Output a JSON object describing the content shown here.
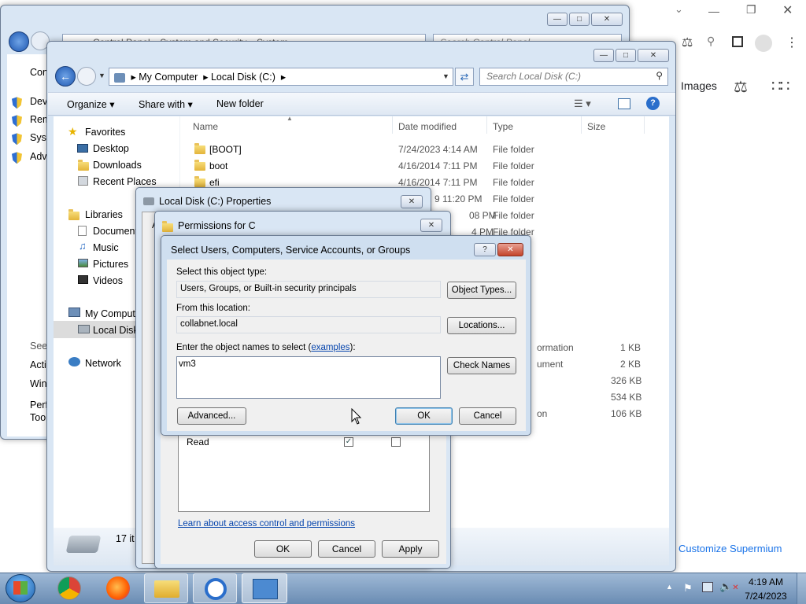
{
  "browser_bg": {
    "links": {
      "images": "Images"
    },
    "customize": "Customize Supermium"
  },
  "control_panel": {
    "breadcrumb": [
      "Control Panel",
      "System and Security",
      "System"
    ],
    "search_placeholder": "Search Control Panel",
    "sidebar": [
      "Con",
      "Devi",
      "Rem",
      "Syst",
      "Adv"
    ],
    "see_also": "See",
    "see_also_items": [
      "Acti",
      "Win",
      "Perf",
      "Too"
    ]
  },
  "explorer": {
    "breadcrumb": [
      "My Computer",
      "Local Disk (C:)"
    ],
    "search_placeholder": "Search Local Disk (C:)",
    "toolbar": {
      "organize": "Organize",
      "share": "Share with",
      "new_folder": "New folder"
    },
    "nav": {
      "favorites": "Favorites",
      "desktop": "Desktop",
      "downloads": "Downloads",
      "recent": "Recent Places",
      "libraries": "Libraries",
      "documents": "Document",
      "music": "Music",
      "pictures": "Pictures",
      "videos": "Videos",
      "computer": "My Comput",
      "local_disk": "Local Disk",
      "network": "Network"
    },
    "columns": {
      "name": "Name",
      "date": "Date modified",
      "type": "Type",
      "size": "Size"
    },
    "rows": [
      {
        "name": "[BOOT]",
        "date": "7/24/2023 4:14 AM",
        "type": "File folder"
      },
      {
        "name": "boot",
        "date": "4/16/2014 7:11 PM",
        "type": "File folder"
      },
      {
        "name": "efi",
        "date": "4/16/2014 7:11 PM",
        "type": "File folder"
      }
    ],
    "partial_rows": [
      {
        "date": "9 11:20 PM",
        "type": "File folder"
      },
      {
        "date": "08 PM",
        "type": "File folder"
      },
      {
        "date": "4 PM",
        "type": "File folder"
      }
    ],
    "partial_right": [
      {
        "type": "ormation",
        "size": "1 KB"
      },
      {
        "type": "ument",
        "size": "2 KB"
      },
      {
        "type": "",
        "size": "326 KB"
      },
      {
        "type": "",
        "size": "534 KB"
      },
      {
        "type": "on",
        "size": "106 KB"
      }
    ],
    "status": "17 it"
  },
  "properties": {
    "title": "Local Disk (C:) Properties",
    "tab_hint": "A",
    "buttons": {
      "ok": "OK",
      "cancel": "Cancel",
      "apply": "Apply"
    }
  },
  "permissions": {
    "title": "Permissions for C",
    "read_label": "Read",
    "link": "Learn about access control and permissions"
  },
  "select_dialog": {
    "title": "Select Users, Computers, Service Accounts, or Groups",
    "help": "?",
    "object_type_label": "Select this object type:",
    "object_type_value": "Users, Groups, or Built-in security principals",
    "object_types_btn": "Object Types...",
    "location_label": "From this location:",
    "location_value": "collabnet.local",
    "locations_btn": "Locations...",
    "names_label_pre": "Enter the object names to select (",
    "names_link": "examples",
    "names_label_post": "):",
    "names_value": "vm3",
    "check_names_btn": "Check Names",
    "advanced_btn": "Advanced...",
    "ok_btn": "OK",
    "cancel_btn": "Cancel"
  },
  "taskbar": {
    "time": "4:19 AM",
    "date": "7/24/2023"
  }
}
